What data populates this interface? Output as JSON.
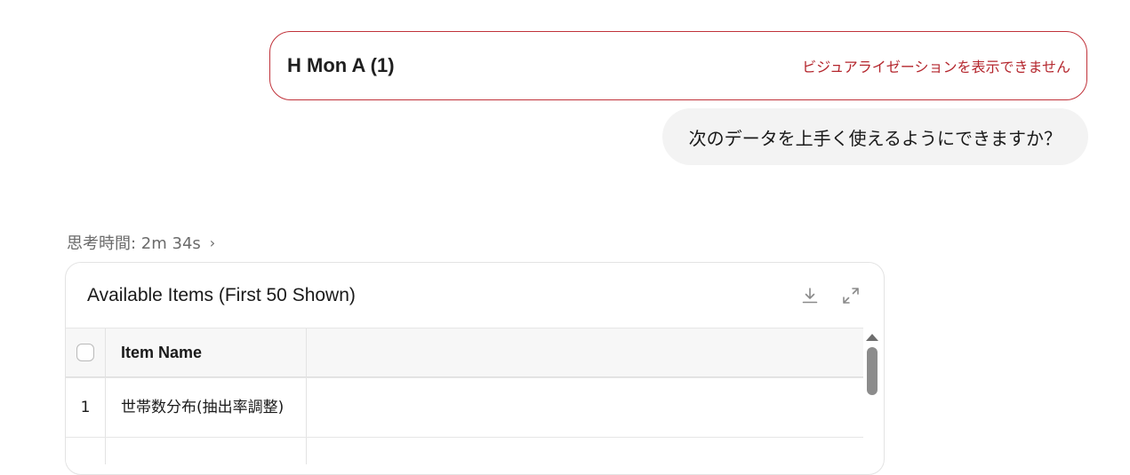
{
  "file_card": {
    "name": "H Mon A (1)",
    "error": "ビジュアライゼーションを表示できません"
  },
  "user_message": "次のデータを上手く使えるようにできますか？",
  "thinking": {
    "label": "思考時間: 2m 34s",
    "chevron": "›"
  },
  "table": {
    "title": "Available Items (First 50 Shown)",
    "tools": {
      "download_icon": "download-icon",
      "expand_icon": "expand-icon"
    },
    "columns": [
      "",
      "Item Name",
      ""
    ],
    "rows": [
      {
        "index": "1",
        "item_name": "世帯数分布(抽出率調整)"
      }
    ]
  }
}
